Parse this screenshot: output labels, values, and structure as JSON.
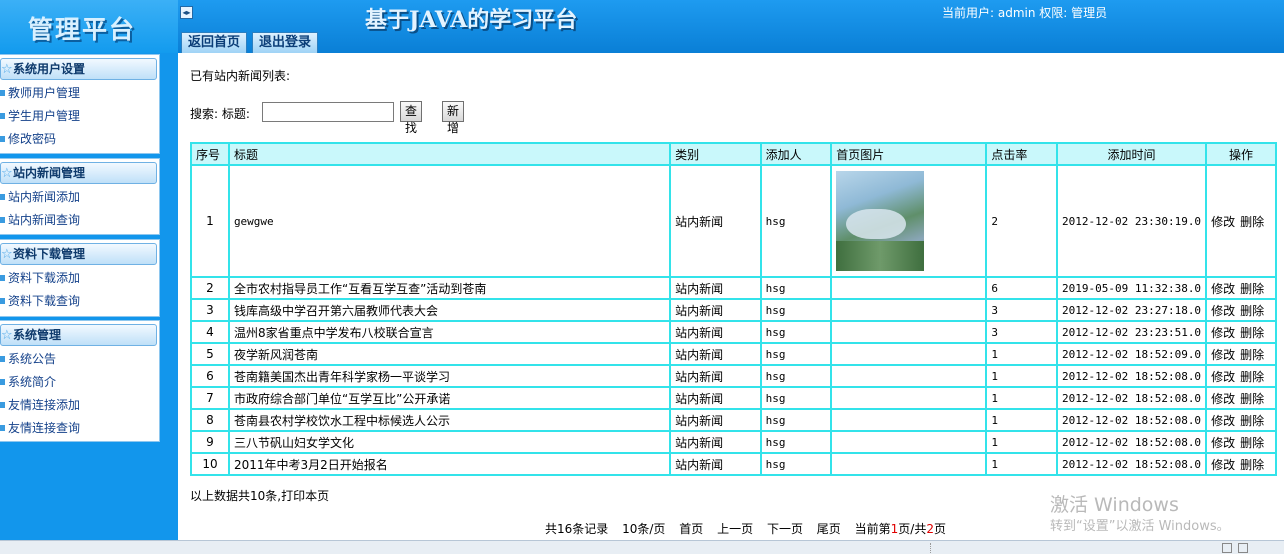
{
  "header": {
    "logo": "管理平台",
    "system_title": "基于JAVA的学习平台",
    "user_info": "当前用户: admin 权限: 管理员",
    "tabs": [
      "返回首页",
      "退出登录"
    ]
  },
  "sidebar": {
    "groups": [
      {
        "title": "系统用户设置",
        "items": [
          "教师用户管理",
          "学生用户管理",
          "修改密码"
        ]
      },
      {
        "title": "站内新闻管理",
        "items": [
          "站内新闻添加",
          "站内新闻查询"
        ]
      },
      {
        "title": "资料下载管理",
        "items": [
          "资料下载添加",
          "资料下载查询"
        ]
      },
      {
        "title": "系统管理",
        "items": [
          "系统公告",
          "系统简介",
          "友情连接添加",
          "友情连接查询"
        ]
      }
    ]
  },
  "main": {
    "heading": "已有站内新闻列表:",
    "search": {
      "label": "搜索: 标题:",
      "value": "",
      "find_label": "查找",
      "add_label": "新增"
    },
    "table": {
      "headers": [
        "序号",
        "标题",
        "类别",
        "添加人",
        "首页图片",
        "点击率",
        "添加时间",
        "操作"
      ],
      "rows": [
        {
          "no": "1",
          "title": "gewgwe",
          "category": "站内新闻",
          "author": "hsg",
          "has_image": true,
          "clicks": "2",
          "time": "2012-12-02 23:30:19.0"
        },
        {
          "no": "2",
          "title": "全市农村指导员工作“互看互学互查”活动到苍南",
          "category": "站内新闻",
          "author": "hsg",
          "has_image": false,
          "clicks": "6",
          "time": "2019-05-09 11:32:38.0"
        },
        {
          "no": "3",
          "title": "钱库高级中学召开第六届教师代表大会",
          "category": "站内新闻",
          "author": "hsg",
          "has_image": false,
          "clicks": "3",
          "time": "2012-12-02 23:27:18.0"
        },
        {
          "no": "4",
          "title": "温州8家省重点中学发布八校联合宣言",
          "category": "站内新闻",
          "author": "hsg",
          "has_image": false,
          "clicks": "3",
          "time": "2012-12-02 23:23:51.0"
        },
        {
          "no": "5",
          "title": "夜学新风润苍南",
          "category": "站内新闻",
          "author": "hsg",
          "has_image": false,
          "clicks": "1",
          "time": "2012-12-02 18:52:09.0"
        },
        {
          "no": "6",
          "title": "苍南籍美国杰出青年科学家杨一平谈学习",
          "category": "站内新闻",
          "author": "hsg",
          "has_image": false,
          "clicks": "1",
          "time": "2012-12-02 18:52:08.0"
        },
        {
          "no": "7",
          "title": "市政府综合部门单位“互学互比”公开承诺",
          "category": "站内新闻",
          "author": "hsg",
          "has_image": false,
          "clicks": "1",
          "time": "2012-12-02 18:52:08.0"
        },
        {
          "no": "8",
          "title": "苍南县农村学校饮水工程中标候选人公示",
          "category": "站内新闻",
          "author": "hsg",
          "has_image": false,
          "clicks": "1",
          "time": "2012-12-02 18:52:08.0"
        },
        {
          "no": "9",
          "title": "三八节矾山妇女学文化",
          "category": "站内新闻",
          "author": "hsg",
          "has_image": false,
          "clicks": "1",
          "time": "2012-12-02 18:52:08.0"
        },
        {
          "no": "10",
          "title": "2011年中考3月2日开始报名",
          "category": "站内新闻",
          "author": "hsg",
          "has_image": false,
          "clicks": "1",
          "time": "2012-12-02 18:52:08.0"
        }
      ],
      "edit_label": "修改",
      "delete_label": "删除"
    },
    "summary": "以上数据共10条,打印本页",
    "pager": {
      "total": "共16条记录",
      "per_page": "10条/页",
      "first": "首页",
      "prev": "上一页",
      "next": "下一页",
      "last": "尾页",
      "current_prefix": "当前第",
      "current_page": "1",
      "mid": "页/共",
      "total_pages": "2",
      "suffix": "页"
    }
  },
  "watermark": {
    "line1": "激活 Windows",
    "line2": "转到“设置”以激活 Windows。"
  }
}
